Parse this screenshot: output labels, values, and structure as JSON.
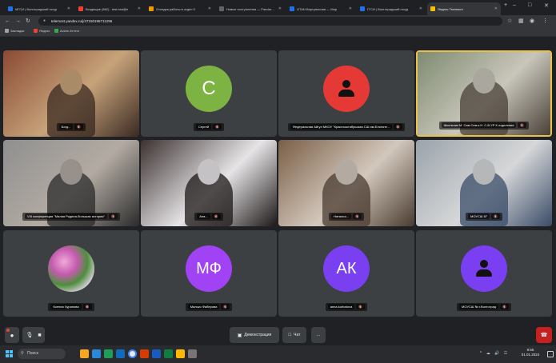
{
  "browser": {
    "tabs": [
      {
        "label": "МГСИ | Волгоградский госуд",
        "color": "#1a73e8",
        "active": false
      },
      {
        "label": "Входящие (862) - test.bsd@e",
        "color": "#ea4335",
        "active": false
      },
      {
        "label": "Отладка работы в отдел 9",
        "color": "#f29900",
        "active": false
      },
      {
        "label": "Новые поступления — Pandaregion",
        "color": "#5f6368",
        "active": false
      },
      {
        "label": "GTAN Виртуальная — Мир",
        "color": "#1a73e8",
        "active": false
      },
      {
        "label": "ГГСИ | Волгоградский госуд",
        "color": "#1a73e8",
        "active": false
      },
      {
        "label": "Яндекс Телемост",
        "color": "#fbbc04",
        "active": true
      }
    ],
    "url": "telemost.yandex.ru/j/47150196711296",
    "bookmarks": [
      {
        "label": "Закладки",
        "color": "#9aa0a6"
      },
      {
        "label": "Яндекс",
        "color": "#ea4335"
      },
      {
        "label": "Avidm Аттест",
        "color": "#34a853"
      }
    ],
    "window_controls": {
      "minimize": "–",
      "maximize": "□",
      "close": "✕"
    }
  },
  "participants": [
    {
      "name": "Богд...",
      "type": "video",
      "palette": [
        "#8a4a34",
        "#c7a37a",
        "#3a2a22"
      ]
    },
    {
      "name": "Сергей",
      "type": "avatar",
      "initials": "С",
      "avatar_color": "#7cb342"
    },
    {
      "name": "Федеральная Айгул МКОУ \"Краснооктябрьская СШ им.Ельтоне...",
      "type": "avatar",
      "initials": "",
      "avatar_color": "#e53935",
      "person_icon": true
    },
    {
      "name": "Школьник М. Сам.Сем.к.Н. С.В.УР К отделения",
      "type": "video",
      "palette": [
        "#7f8b70",
        "#c8c6ba",
        "#4a4038"
      ],
      "speaking": true
    },
    {
      "name": "VIII конференция \"Малая Родина-большая история\"",
      "type": "video",
      "palette": [
        "#8f8f8f",
        "#b3aba3",
        "#2b2b2b"
      ]
    },
    {
      "name": "Ана...",
      "type": "video",
      "palette": [
        "#3b3130",
        "#e6e4e6",
        "#1d1817"
      ]
    },
    {
      "name": "Наталья...",
      "type": "video",
      "palette": [
        "#7a5e46",
        "#d3c8bd",
        "#4a3b30"
      ]
    },
    {
      "name": "МОУСШ 87",
      "type": "video",
      "palette": [
        "#9aa3ab",
        "#d6d7d8",
        "#3a4c68"
      ]
    },
    {
      "name": "Ксения Чуранова",
      "type": "avatar",
      "initials": "",
      "avatar_color": "#d9c7e8",
      "photo": true
    },
    {
      "name": "Малько Фаберова",
      "type": "avatar",
      "initials": "МФ",
      "avatar_color": "#a142f4"
    },
    {
      "name": "anna.kurbatova",
      "type": "avatar",
      "initials": "АК",
      "avatar_color": "#7b3ff2"
    },
    {
      "name": "МОУСШ № г.Волгоград",
      "type": "avatar",
      "initials": "",
      "avatar_color": "#7b3ff2",
      "person_icon": true
    }
  ],
  "controls": {
    "demo_label": "Демонстрация",
    "chat_label": "Чат",
    "more_label": "…"
  },
  "taskbar": {
    "search_label": "Поиск",
    "time": "9:55",
    "date": "01.01.2024"
  },
  "colors": {
    "background": "#202124",
    "tile": "#3c4043",
    "speaking_border": "#e8c24a",
    "leave_button": "#c5221f"
  }
}
